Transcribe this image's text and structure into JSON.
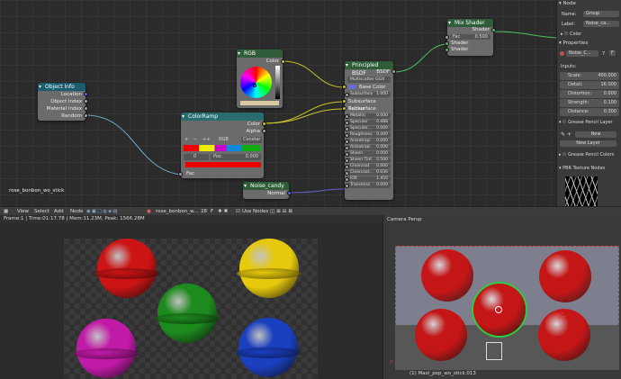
{
  "nodes": {
    "object_info": {
      "title": "Object Info",
      "outputs": [
        "Location",
        "Object Index",
        "Material Index",
        "Random"
      ]
    },
    "rgb": {
      "title": "RGB",
      "output": "Color"
    },
    "colorramp": {
      "title": "ColorRamp",
      "outputs": [
        "Color",
        "Alpha"
      ],
      "add": "+",
      "remove": "−",
      "more": "++",
      "mode": "RGB",
      "interp": "Constar",
      "index": "0",
      "pos_label": "Pos:",
      "pos_value": "0.000",
      "input": "Fac"
    },
    "noise": {
      "title": "Noise_candy",
      "output": "Normal"
    },
    "principled": {
      "title": "Principled BSDF",
      "output": "BSDF",
      "method": "Multiscatter GGX",
      "rows": [
        {
          "label": "Base Color",
          "kind": "color"
        },
        {
          "label": "Subsurface",
          "value": "1.000",
          "kind": "field"
        },
        {
          "label": "Subsurface Radius",
          "kind": "plain"
        },
        {
          "label": "Subsurface Color",
          "kind": "plain"
        },
        {
          "label": "Metallic",
          "value": "0.000",
          "kind": "field"
        },
        {
          "label": "Specular",
          "value": "0.488",
          "kind": "field"
        },
        {
          "label": "Specular...",
          "value": "0.000",
          "kind": "field"
        },
        {
          "label": "Roughness",
          "value": "0.400",
          "kind": "field"
        },
        {
          "label": "Anisotropi",
          "value": "0.000",
          "kind": "field"
        },
        {
          "label": "Anisotropi",
          "value": "0.000",
          "kind": "field"
        },
        {
          "label": "Sheen",
          "value": "0.000",
          "kind": "field"
        },
        {
          "label": "Sheen Tint",
          "value": "0.500",
          "kind": "field"
        },
        {
          "label": "Clearcoat",
          "value": "0.000",
          "kind": "field"
        },
        {
          "label": "Clearcoat...",
          "value": "0.030",
          "kind": "field"
        },
        {
          "label": "IOR",
          "value": "1.450",
          "kind": "field"
        },
        {
          "label": "Transmiss",
          "value": "0.000",
          "kind": "field"
        }
      ]
    },
    "mix": {
      "title": "Mix Shader",
      "output": "Shader",
      "fac_label": "Fac",
      "fac_value": "0.500",
      "inputs": [
        "Shader",
        "Shader"
      ]
    }
  },
  "material_name": "rose_bonbon_wo_stick",
  "panel": {
    "section_node": "Node",
    "name_label": "Name:",
    "name_value": "Group",
    "label_label": "Label:",
    "label_value": "Noise_ca...",
    "color_label": "Color",
    "properties_label": "Properties",
    "group_name": "Noise_C...",
    "group_users": "7",
    "group_f": "F",
    "inputs_label": "Inputs:",
    "inputs": [
      {
        "label": "Scale:",
        "value": "400.000"
      },
      {
        "label": "Detail:",
        "value": "16.000"
      },
      {
        "label": "Distortion:",
        "value": "0.000"
      },
      {
        "label": "Strength:",
        "value": "0.100"
      },
      {
        "label": "Distance:",
        "value": "0.300"
      }
    ],
    "gp_layer": "Grease Pencil Layer",
    "gp_new": "New",
    "gp_new_layer": "New Layer",
    "gp_colors": "Grease Pencil Colors",
    "pbr": "PBR Texture Nodes"
  },
  "header": {
    "view": "View",
    "select": "Select",
    "add": "Add",
    "node": "Node",
    "material": "rose_bonbon_w...",
    "users": "28",
    "f": "F",
    "use_nodes": "Use Nodes"
  },
  "status": "Frame:1 | Time:01:17.78 | Mem:11.23M, Peak: 1566.28M",
  "viewport": {
    "title": "Camera Persp",
    "object": "(1) Maxi_pop_wo_stick.013"
  },
  "colors": {
    "red": "#cc1414",
    "yellow": "#e6c90d",
    "green": "#1d8a1d",
    "magenta": "#c21aa8",
    "blue": "#1a3fbf"
  }
}
